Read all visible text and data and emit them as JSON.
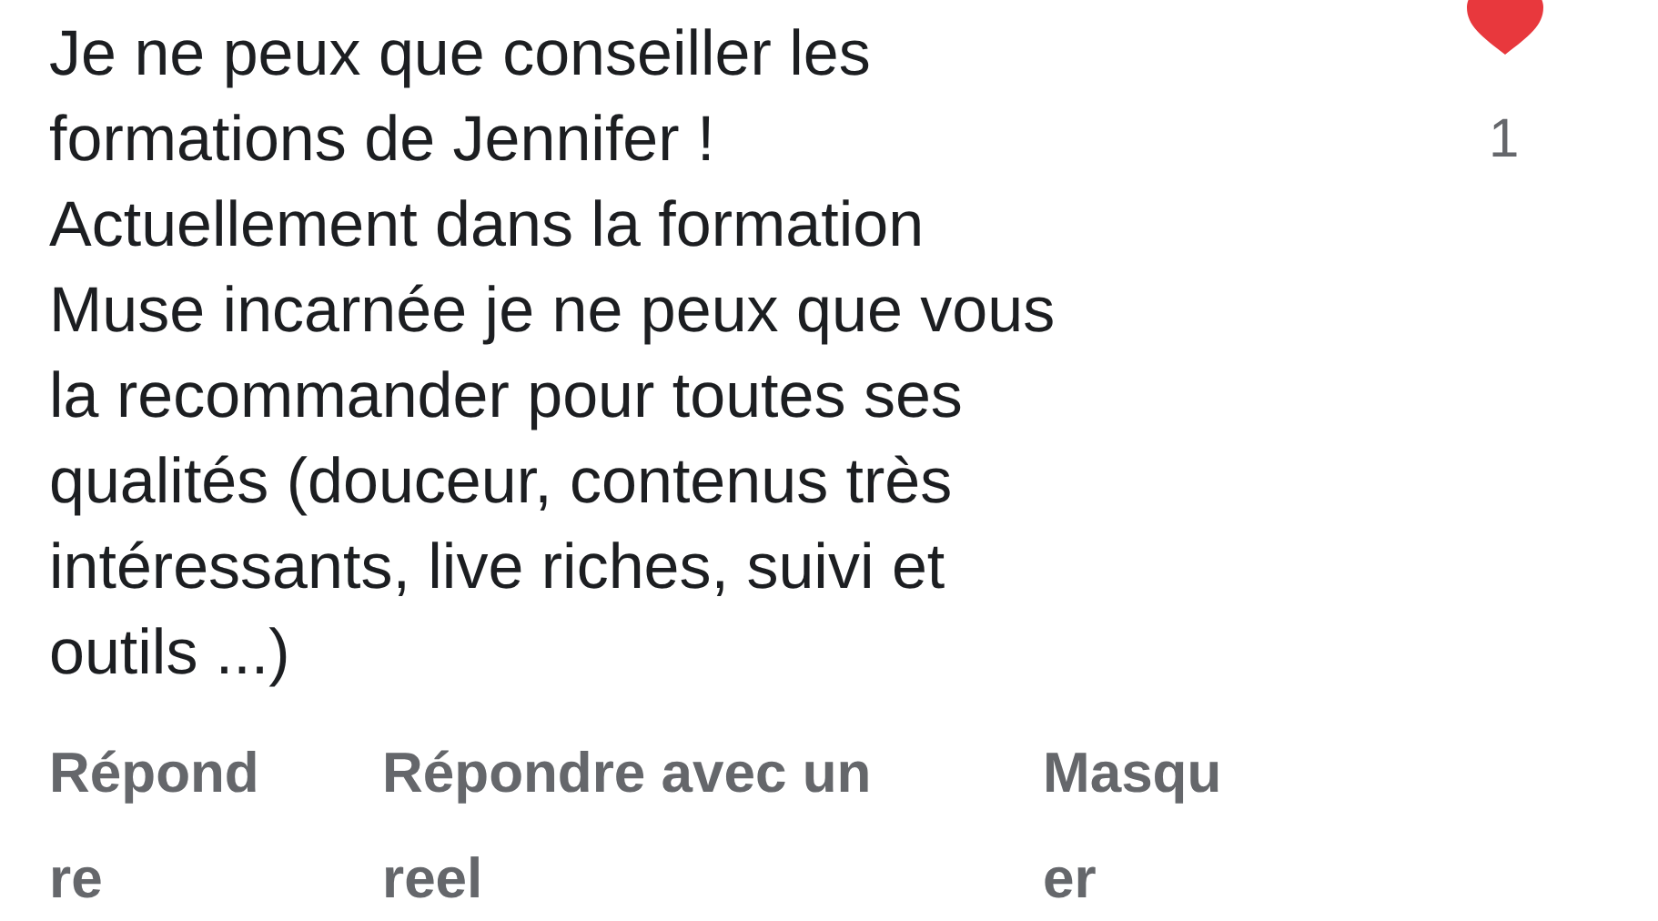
{
  "comment": {
    "lines": [
      "Je ne peux que conseiller les",
      "formations de Jennifer !",
      "Actuellement dans la formation",
      "Muse incarnée je ne peux que vous",
      "la recommander pour toutes ses",
      "qualités (douceur, contenus très",
      "intéressants, live riches, suivi et",
      "outils ...)"
    ]
  },
  "like": {
    "liked": true,
    "count": "1"
  },
  "actions": [
    {
      "lines": [
        "Répond",
        "re"
      ]
    },
    {
      "lines": [
        "Répondre avec un",
        "reel"
      ]
    },
    {
      "lines": [
        "Masqu",
        "er"
      ]
    }
  ]
}
